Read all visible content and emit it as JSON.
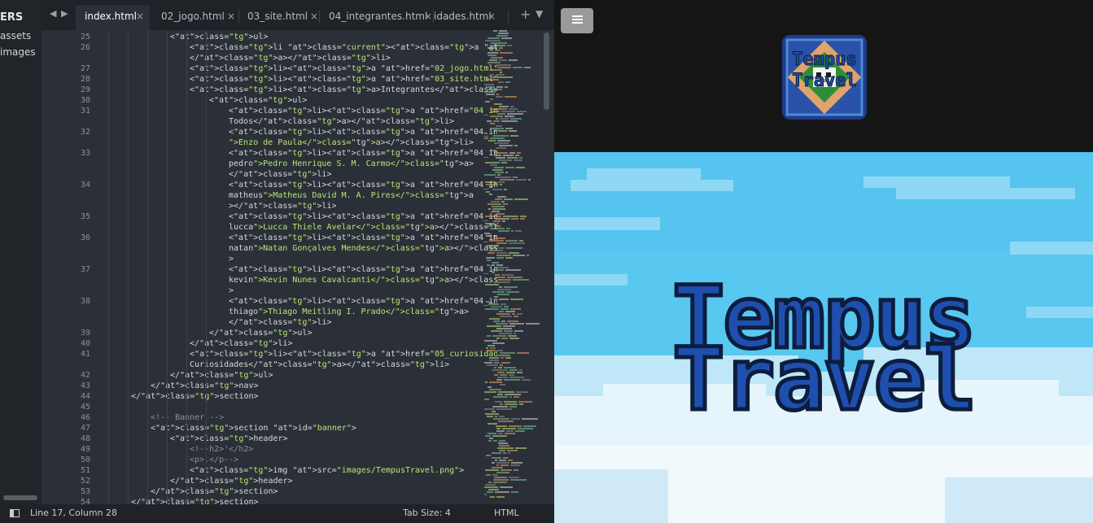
{
  "sidebar": {
    "title": "ERS",
    "items": [
      {
        "label": "assets"
      },
      {
        "label": "images"
      }
    ]
  },
  "tabs": [
    {
      "label": "index.html",
      "active": true
    },
    {
      "label": "02_jogo.html",
      "active": false
    },
    {
      "label": "03_site.html",
      "active": false
    },
    {
      "label": "04_integrantes.html",
      "active": false
    },
    {
      "label": "idades.html",
      "active": false
    }
  ],
  "tab_actions": {
    "close": "×",
    "new": "+",
    "more": "▼"
  },
  "line_numbers": [
    "25",
    "26",
    "27",
    "28",
    "29",
    "30",
    "31",
    "32",
    "33",
    "34",
    "35",
    "36",
    "37",
    "38",
    "39",
    "40",
    "41",
    "42",
    "43",
    "44",
    "45",
    "46",
    "47",
    "48",
    "49",
    "50",
    "51",
    "52",
    "53",
    "54"
  ],
  "code_lines": [
    "<ul>",
    "<li class=\"current\"><a href=\"index.html\">Home",
    "</a></li>",
    "<li><a href=\"02_jogo.html\">Jogo</a></li>",
    "<li><a href=\"03_site.html\">Site</a></li>",
    "<li><a>Integrantes</a>",
    "<ul>",
    "<li><a href=\"04_integrantes.html\">",
    "Todos</a></li>",
    "<li><a href=\"04_integrantes.html#enzo",
    "\">Enzo de Paula</a></li>",
    "<li><a href=\"04_integrantes.html#",
    "pedro\">Pedro Henrique S. M. Carmo</a>",
    "</li>",
    "<li><a href=\"04_integrantes.html#",
    "matheus\">Matheus David M. A. Pires</a",
    "></li>",
    "<li><a href=\"04_integrantes.html#",
    "lucca\">Lucca Thiele Avelar</a></li>",
    "<li><a href=\"04_integrantes.html#",
    "natan\">Natan Gonçalves Mendes</a></li",
    ">",
    "<li><a href=\"04_integrantes.html#",
    "kevin\">Kevin Nunes Cavalcanti</a></li",
    ">",
    "<li><a href=\"04_integrantes.html#",
    "thiago\">Thiago Meitling I. Prado</a>",
    "</li>",
    "</ul>",
    "</li>",
    "<li><a href=\"05_curiosidades.html\">",
    "Curiosidades</a></li>",
    "</ul>",
    "</nav>",
    "</section>",
    "",
    "<!-- Banner -->",
    "<section id=\"banner\">",
    "<header>",
    "<!--h2>'</h2>",
    "<p>.</p-->",
    "<img src=\"images/TempusTravel.png\">",
    "</header>",
    "</section>",
    "</section>"
  ],
  "status": {
    "position": "Line 17, Column 28",
    "tab_size": "Tab Size: 4",
    "syntax": "HTML"
  },
  "preview": {
    "menu_icon": "hamburger-icon",
    "logo_text_line1": "Tempus",
    "logo_text_line2": "Travel",
    "banner_title_line1": "Tempus",
    "banner_title_line2": "Travel"
  }
}
